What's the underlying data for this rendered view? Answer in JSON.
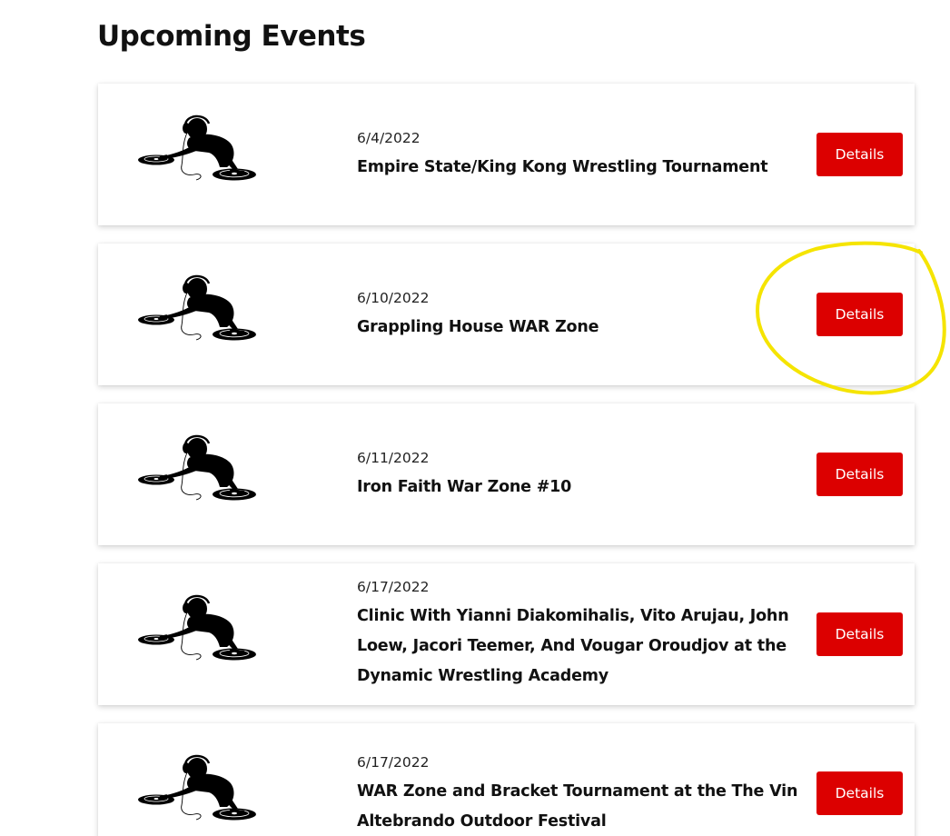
{
  "page": {
    "title": "Upcoming Events"
  },
  "events": [
    {
      "date": "6/4/2022",
      "name": "Empire State/King Kong Wrestling Tournament",
      "button": "Details"
    },
    {
      "date": "6/10/2022",
      "name": "Grappling House WAR Zone",
      "button": "Details"
    },
    {
      "date": "6/11/2022",
      "name": "Iron Faith War Zone #10",
      "button": "Details"
    },
    {
      "date": "6/17/2022",
      "name": "Clinic With Yianni Diakomihalis, Vito Arujau, John Loew, Jacori Teemer, And Vougar Oroudjov at the Dynamic Wrestling Academy",
      "button": "Details"
    },
    {
      "date": "6/17/2022",
      "name": "WAR Zone and Bracket Tournament at the The Vin Altebrando Outdoor Festival",
      "button": "Details"
    }
  ],
  "thumbnail_icon": "dj-turntables-silhouette-icon",
  "colors": {
    "button_bg": "#dc0000",
    "button_text": "#ffffff",
    "annotation_circle": "#f5e400"
  }
}
